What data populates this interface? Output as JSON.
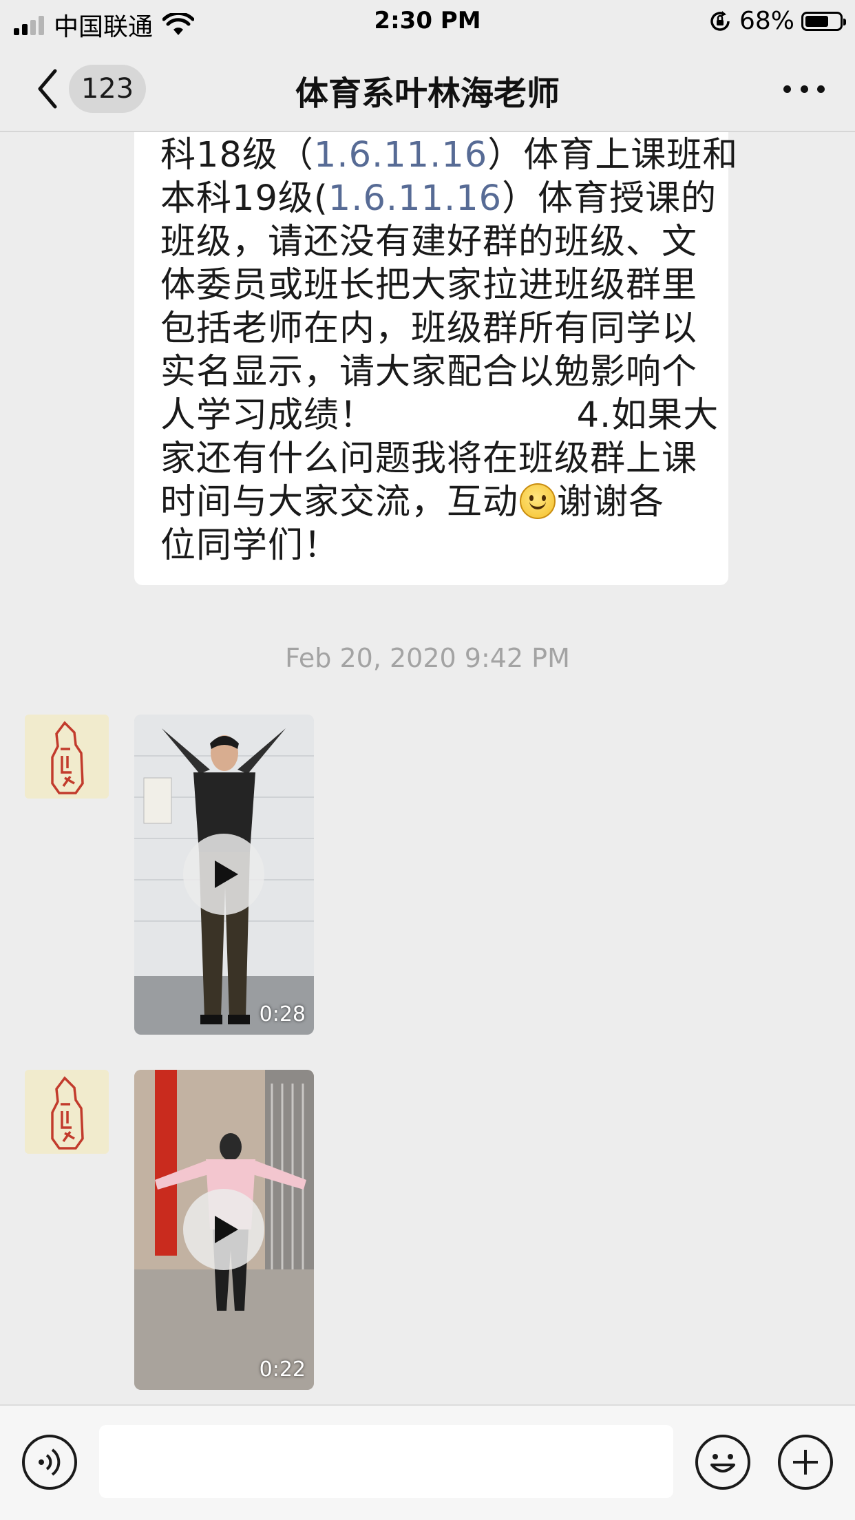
{
  "status_bar": {
    "carrier": "中国联通",
    "time": "2:30 PM",
    "battery_percent": "68%",
    "battery_level": 0.68,
    "signal_bars": 2
  },
  "nav": {
    "back_badge": "123",
    "title": "体育系叶林海老师"
  },
  "message": {
    "lines": [
      {
        "parts": [
          {
            "t": "科18级（"
          },
          {
            "t": "1.6.11.16",
            "link": true
          },
          {
            "t": "）体育上课班和"
          }
        ]
      },
      {
        "parts": [
          {
            "t": "本科19级("
          },
          {
            "t": "1.6.11.16",
            "link": true
          },
          {
            "t": "）体育授课的"
          }
        ]
      },
      {
        "parts": [
          {
            "t": "班级，请还没有建好群的班级、文"
          }
        ]
      },
      {
        "parts": [
          {
            "t": "体委员或班长把大家拉进班级群里"
          }
        ]
      },
      {
        "parts": [
          {
            "t": "包括老师在内，班级群所有同学以"
          }
        ]
      },
      {
        "parts": [
          {
            "t": "实名显示，请大家配合以勉影响个"
          }
        ]
      },
      {
        "parts": [
          {
            "t": "人学习成绩！                 4.如果大"
          }
        ]
      },
      {
        "parts": [
          {
            "t": "家还有什么问题我将在班级群上课"
          }
        ]
      },
      {
        "parts": [
          {
            "t": "时间与大家交流，互动"
          },
          {
            "emoji": "smile"
          },
          {
            "t": "谢谢各"
          }
        ]
      },
      {
        "parts": [
          {
            "t": "位同学们！"
          }
        ]
      }
    ]
  },
  "timestamp": "Feb 20, 2020 9:42 PM",
  "videos": [
    {
      "duration": "0:28"
    },
    {
      "duration": "0:22"
    }
  ],
  "icons": {
    "back": "chevron-left-icon",
    "more": "more-icon",
    "voice": "voice-icon",
    "emoji": "emoji-icon",
    "add": "plus-icon",
    "play": "play-icon"
  },
  "colors": {
    "link": "#576b95",
    "background": "#ededed",
    "bubble": "#ffffff"
  }
}
